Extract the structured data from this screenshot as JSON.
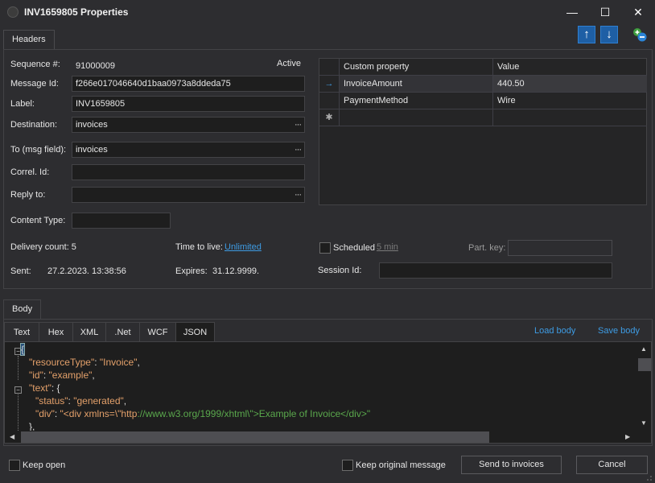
{
  "window": {
    "title": "INV1659805 Properties",
    "minimize_glyph": "—",
    "maximize_glyph": "☐",
    "close_glyph": "✕"
  },
  "headers_tab": {
    "label": "Headers"
  },
  "toolbar": {
    "move_up_icon": "arrow-up-icon",
    "move_down_icon": "arrow-down-icon",
    "add_remove_icon": "add-remove-property-icon"
  },
  "fields": {
    "sequence_label": "Sequence #:",
    "sequence_value": "91000009",
    "status": "Active",
    "message_id_label": "Message Id:",
    "message_id_value": "f266e017046640d1baa0973a8ddeda75",
    "label_label": "Label:",
    "label_value": "INV1659805",
    "destination_label": "Destination:",
    "destination_value": "invoices",
    "to_label": "To (msg field):",
    "to_value": "invoices",
    "correl_label": "Correl. Id:",
    "correl_value": "",
    "reply_label": "Reply to:",
    "reply_value": "",
    "content_type_label": "Content Type:",
    "content_type_value": "",
    "browse": "···"
  },
  "properties": {
    "columns": [
      "Custom property",
      "Value"
    ],
    "rows": [
      {
        "name": "InvoiceAmount",
        "value": "440.50"
      },
      {
        "name": "PaymentMethod",
        "value": "Wire"
      }
    ],
    "current_row_marker": "→",
    "new_row_marker": "✱"
  },
  "info": {
    "delivery_count": "Delivery count: 5",
    "time_to_live_label": "Time to live:",
    "time_to_live_value": "Unlimited",
    "scheduled_label": "Scheduled",
    "scheduled_link": "5 min",
    "part_key_label": "Part. key:",
    "part_key_value": "",
    "sent_label": "Sent:",
    "sent_value": "27.2.2023.  13:38:56",
    "expires_label": "Expires:",
    "expires_value": "31.12.9999.",
    "session_label": "Session Id:",
    "session_value": ""
  },
  "body": {
    "tab_label": "Body",
    "subtabs": [
      "Text",
      "Hex",
      "XML",
      ".Net",
      "WCF",
      "JSON"
    ],
    "active_subtab": "JSON",
    "load_body": "Load body",
    "save_body": "Save body",
    "code": {
      "l1": "{",
      "l2_key": "\"resourceType\"",
      "l2_val": "\"Invoice\"",
      "l3_key": "\"id\"",
      "l3_val": "\"example\"",
      "l4_key": "\"text\"",
      "l5_key": "\"status\"",
      "l5_val": "\"generated\"",
      "l6_key": "\"div\"",
      "l6_val_a": "\"<div xmlns=\\\"http",
      "l6_val_b": "://www.w3.org/1999/xhtml\\\">Example of Invoice</div>\"",
      "l7": "},"
    }
  },
  "footer": {
    "keep_open": "Keep open",
    "keep_original": "Keep original message",
    "send_button": "Send to invoices",
    "cancel_button": "Cancel"
  }
}
